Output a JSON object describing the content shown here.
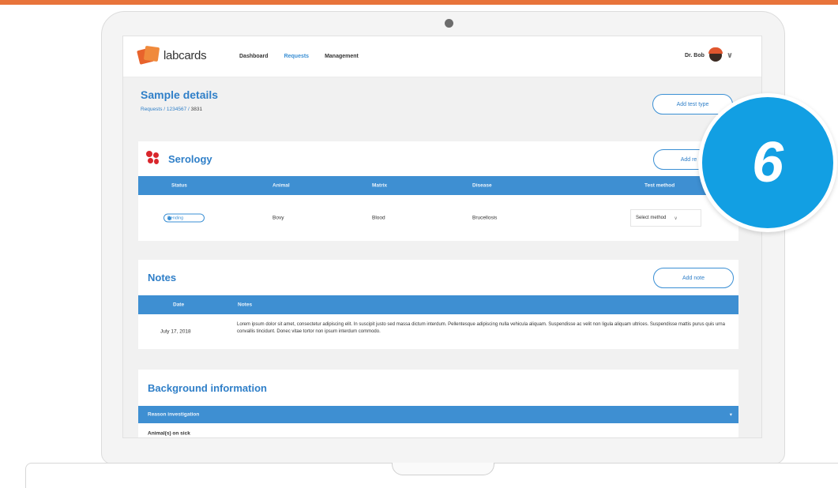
{
  "app": {
    "logo_text": "labcards",
    "nav": [
      "Dashboard",
      "Requests",
      "Management"
    ],
    "active_nav": "Requests",
    "user_name": "Dr. Bob",
    "chevron": "∨"
  },
  "page": {
    "title": "Sample details",
    "breadcrumb_path": "Requests / 1234567 / ",
    "breadcrumb_current": "3831",
    "add_test_button": "Add test type"
  },
  "serology": {
    "title": "Serology",
    "add_button": "Add re",
    "columns": [
      "Status",
      "Animal",
      "Matrix",
      "Disease",
      "Test method"
    ],
    "rows": [
      {
        "status": "Pending",
        "animal": "Bovy",
        "matrix": "Blood",
        "disease": "Brucellosis",
        "method": "Select method"
      }
    ]
  },
  "notes": {
    "title": "Notes",
    "add_button": "Add note",
    "columns": [
      "Date",
      "Notes"
    ],
    "rows": [
      {
        "date": "July 17, 2018",
        "text": "Lorem ipsum dolor sit amet, consectetur adipiscing elit. In suscipit justo sed massa dictum interdum. Pellentesque adipiscing nulla vehicula aliquam. Suspendisse ac velit non ligula aliquam ultrices. Suspendisse mattis purus quis urna convallis tincidunt. Donec vitae tortor non ipsum interdum commodo."
      }
    ]
  },
  "background": {
    "title": "Background information",
    "accordion_label": "Reason investigation",
    "accordion_icon": "▾",
    "row_label": "Animal(s) on sick"
  },
  "step_badge": {
    "number": "6"
  },
  "colors": {
    "accent": "#2f7fc8",
    "table_header": "#3e8fd2",
    "brand_orange": "#e8632c",
    "step_badge": "#129fe3",
    "top_strip": "#e8743b"
  }
}
